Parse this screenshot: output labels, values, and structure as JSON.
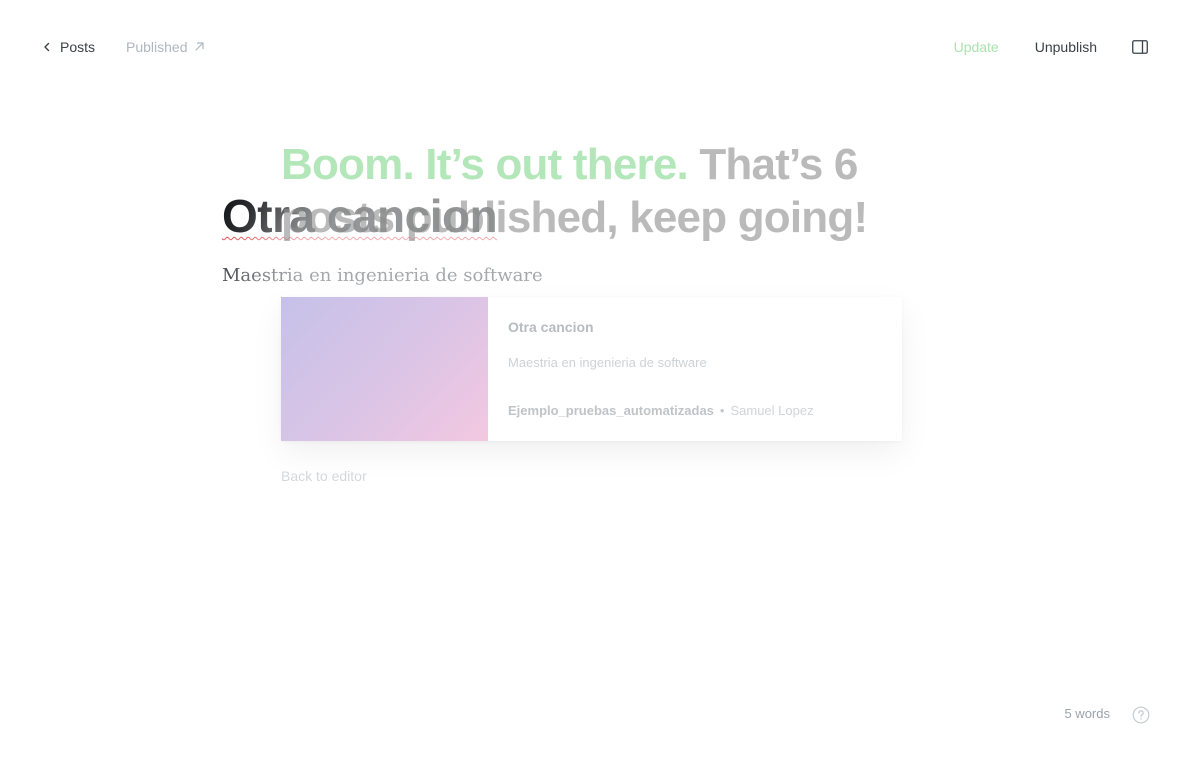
{
  "topbar": {
    "back_label": "Posts",
    "status_label": "Published",
    "update_label": "Update",
    "unpublish_label": "Unpublish"
  },
  "editor": {
    "title": "Otra cancion",
    "excerpt": "Maestria en ingenieria de software",
    "word_count": "5 words"
  },
  "publish_modal": {
    "headline_accent": "Boom. It’s out there.",
    "headline_rest": "That’s 6 posts published, keep going!",
    "card": {
      "title": "Otra cancion",
      "excerpt": "Maestria en ingenieria de software",
      "site": "Ejemplo_pruebas_automatizadas",
      "separator": "•",
      "author": "Samuel Lopez"
    },
    "back_label": "Back to editor"
  },
  "colors": {
    "accent_green": "#a8e3b0",
    "text_dark": "#15171a",
    "muted": "#aeb7c1",
    "gradient_start": "#c6c1e9",
    "gradient_end": "#f3c8e1"
  },
  "icons": {
    "back": "chevron-left-icon",
    "status": "arrow-up-right-icon",
    "sidebar": "sidebar-toggle-icon",
    "help": "question-circle-icon"
  }
}
